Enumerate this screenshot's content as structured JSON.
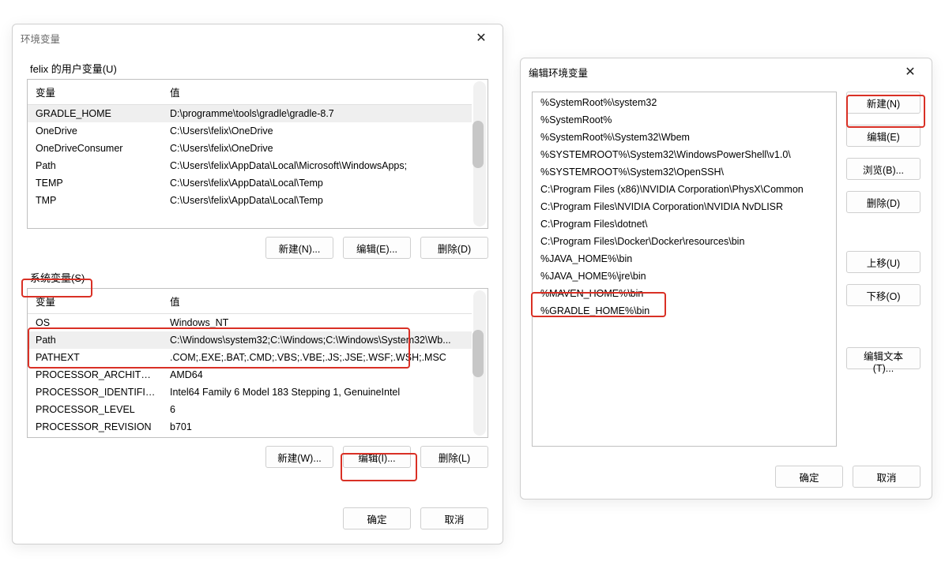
{
  "leftDialog": {
    "title": "环境变量",
    "userVars": {
      "label": "felix 的用户变量(U)",
      "headers": {
        "var": "变量",
        "val": "值"
      },
      "rows": [
        {
          "var": "GRADLE_HOME",
          "val": "D:\\programme\\tools\\gradle\\gradle-8.7"
        },
        {
          "var": "OneDrive",
          "val": "C:\\Users\\felix\\OneDrive"
        },
        {
          "var": "OneDriveConsumer",
          "val": "C:\\Users\\felix\\OneDrive"
        },
        {
          "var": "Path",
          "val": "C:\\Users\\felix\\AppData\\Local\\Microsoft\\WindowsApps;"
        },
        {
          "var": "TEMP",
          "val": "C:\\Users\\felix\\AppData\\Local\\Temp"
        },
        {
          "var": "TMP",
          "val": "C:\\Users\\felix\\AppData\\Local\\Temp"
        }
      ],
      "btnNew": "新建(N)...",
      "btnEdit": "编辑(E)...",
      "btnDelete": "删除(D)"
    },
    "sysVars": {
      "label": "系统变量(S)",
      "headers": {
        "var": "变量",
        "val": "值"
      },
      "rows": [
        {
          "var": "OS",
          "val": "Windows_NT"
        },
        {
          "var": "Path",
          "val": "C:\\Windows\\system32;C:\\Windows;C:\\Windows\\System32\\Wb..."
        },
        {
          "var": "PATHEXT",
          "val": ".COM;.EXE;.BAT;.CMD;.VBS;.VBE;.JS;.JSE;.WSF;.WSH;.MSC"
        },
        {
          "var": "PROCESSOR_ARCHITECT...",
          "val": "AMD64"
        },
        {
          "var": "PROCESSOR_IDENTIFIER",
          "val": "Intel64 Family 6 Model 183 Stepping 1, GenuineIntel"
        },
        {
          "var": "PROCESSOR_LEVEL",
          "val": "6"
        },
        {
          "var": "PROCESSOR_REVISION",
          "val": "b701"
        }
      ],
      "btnNew": "新建(W)...",
      "btnEdit": "编辑(I)...",
      "btnDelete": "删除(L)"
    },
    "btnOK": "确定",
    "btnCancel": "取消"
  },
  "rightDialog": {
    "title": "编辑环境变量",
    "items": [
      "%SystemRoot%\\system32",
      "%SystemRoot%",
      "%SystemRoot%\\System32\\Wbem",
      "%SYSTEMROOT%\\System32\\WindowsPowerShell\\v1.0\\",
      "%SYSTEMROOT%\\System32\\OpenSSH\\",
      "C:\\Program Files (x86)\\NVIDIA Corporation\\PhysX\\Common",
      "C:\\Program Files\\NVIDIA Corporation\\NVIDIA NvDLISR",
      "C:\\Program Files\\dotnet\\",
      "C:\\Program Files\\Docker\\Docker\\resources\\bin",
      "%JAVA_HOME%\\bin",
      "%JAVA_HOME%\\jre\\bin",
      "%MAVEN_HOME%\\bin",
      "%GRADLE_HOME%\\bin"
    ],
    "btnNew": "新建(N)",
    "btnEdit": "编辑(E)",
    "btnBrowse": "浏览(B)...",
    "btnDelete": "删除(D)",
    "btnUp": "上移(U)",
    "btnDown": "下移(O)",
    "btnEditText": "编辑文本(T)...",
    "btnOK": "确定",
    "btnCancel": "取消"
  }
}
